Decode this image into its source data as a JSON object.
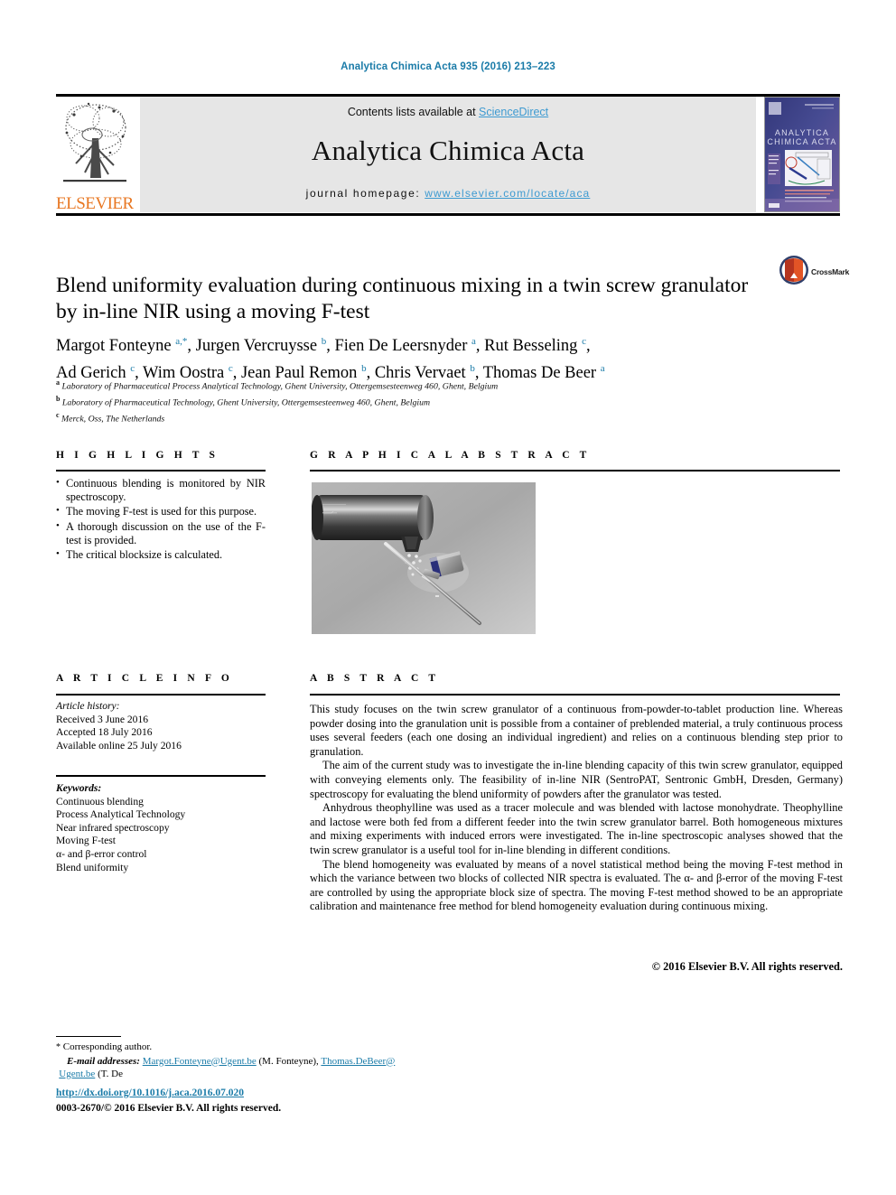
{
  "running_head": "Analytica Chimica Acta 935 (2016) 213–223",
  "journal_header": {
    "contents_prefix": "Contents lists available at ",
    "sciencedirect": "ScienceDirect",
    "journal_name": "Analytica Chimica Acta",
    "homepage_label": "journal homepage: ",
    "homepage_url": "www.elsevier.com/locate/aca",
    "publisher_wordmark": "ELSEVIER",
    "colors": {
      "link_blue": "#3d9ad1",
      "elsevier_orange": "#e87722",
      "band_gray": "#e6e6e6",
      "running_head_blue": "#1a7ba8"
    }
  },
  "article": {
    "title": "Blend uniformity evaluation during continuous mixing in a twin screw granulator by in-line NIR using a moving F-test",
    "crossmark_label": "CrossMark",
    "authors_line1_parts": [
      {
        "name": "Margot Fonteyne",
        "marks": "a,",
        "star": true,
        "sep": ", "
      },
      {
        "name": "Jurgen Vercruysse",
        "marks": "b",
        "star": false,
        "sep": ", "
      },
      {
        "name": "Fien De Leersnyder",
        "marks": "a",
        "star": false,
        "sep": ", "
      },
      {
        "name": "Rut Besseling",
        "marks": "c",
        "star": false,
        "sep": ","
      }
    ],
    "authors_line2_parts": [
      {
        "name": "Ad Gerich",
        "marks": "c",
        "star": false,
        "sep": ", "
      },
      {
        "name": "Wim Oostra",
        "marks": "c",
        "star": false,
        "sep": ", "
      },
      {
        "name": "Jean Paul Remon",
        "marks": "b",
        "star": false,
        "sep": ", "
      },
      {
        "name": "Chris Vervaet",
        "marks": "b",
        "star": false,
        "sep": ", "
      },
      {
        "name": "Thomas De Beer",
        "marks": "a",
        "star": false,
        "sep": ""
      }
    ],
    "affiliations": [
      {
        "mark": "a",
        "text": "Laboratory of Pharmaceutical Process Analytical Technology, Ghent University, Ottergemsesteenweg 460, Ghent, Belgium"
      },
      {
        "mark": "b",
        "text": "Laboratory of Pharmaceutical Technology, Ghent University, Ottergemsesteenweg 460, Ghent, Belgium"
      },
      {
        "mark": "c",
        "text": "Merck, Oss, The Netherlands"
      }
    ]
  },
  "highlights": {
    "heading": "H I G H L I G H T S",
    "items": [
      "Continuous blending is monitored by NIR spectroscopy.",
      "The moving F-test is used for this purpose.",
      "A thorough discussion on the use of the F-test is provided.",
      "The critical blocksize is calculated."
    ]
  },
  "graphical_abstract": {
    "heading": "G R A P H I C A L   A B S T R A C T",
    "image_alt": "twin-screw-granulator-render"
  },
  "article_info": {
    "heading": "A R T I C L E   I N F O",
    "history_label": "Article history:",
    "history": [
      "Received 3 June 2016",
      "Accepted 18 July 2016",
      "Available online 25 July 2016"
    ],
    "keywords_label": "Keywords:",
    "keywords": [
      "Continuous blending",
      "Process Analytical Technology",
      "Near infrared spectroscopy",
      "Moving F-test",
      "α- and β-error control",
      "Blend uniformity"
    ]
  },
  "abstract": {
    "heading": "A B S T R A C T",
    "paragraphs": [
      "This study focuses on the twin screw granulator of a continuous from-powder-to-tablet production line. Whereas powder dosing into the granulation unit is possible from a container of preblended material, a truly continuous process uses several feeders (each one dosing an individual ingredient) and relies on a continuous blending step prior to granulation.",
      "The aim of the current study was to investigate the in-line blending capacity of this twin screw granulator, equipped with conveying elements only. The feasibility of in-line NIR (SentroPAT, Sentronic GmbH, Dresden, Germany) spectroscopy for evaluating the blend uniformity of powders after the granulator was tested.",
      "Anhydrous theophylline was used as a tracer molecule and was blended with lactose monohydrate. Theophylline and lactose were both fed from a different feeder into the twin screw granulator barrel. Both homogeneous mixtures and mixing experiments with induced errors were investigated. The in-line spectroscopic analyses showed that the twin screw granulator is a useful tool for in-line blending in different conditions.",
      "The blend homogeneity was evaluated by means of a novel statistical method being the moving F-test method in which the variance between two blocks of collected NIR spectra is evaluated. The α- and β-error of the moving F-test are controlled by using the appropriate block size of spectra. The moving F-test method showed to be an appropriate calibration and maintenance free method for blend homogeneity evaluation during continuous mixing."
    ],
    "copyright": "© 2016 Elsevier B.V. All rights reserved."
  },
  "footer": {
    "corresponding_star": "*",
    "corresponding_text": "Corresponding author.",
    "email_label": "E-mail addresses:",
    "email1": "Margot.Fonteyne@Ugent.be",
    "email1_owner": "(M. Fonteyne),",
    "email2a": "Thomas.DeBeer@",
    "email2b": "Ugent.be",
    "email2_owner": "(T. De Beer).",
    "doi": "http://dx.doi.org/10.1016/j.aca.2016.07.020",
    "issn_line": "0003-2670/© 2016 Elsevier B.V. All rights reserved."
  }
}
